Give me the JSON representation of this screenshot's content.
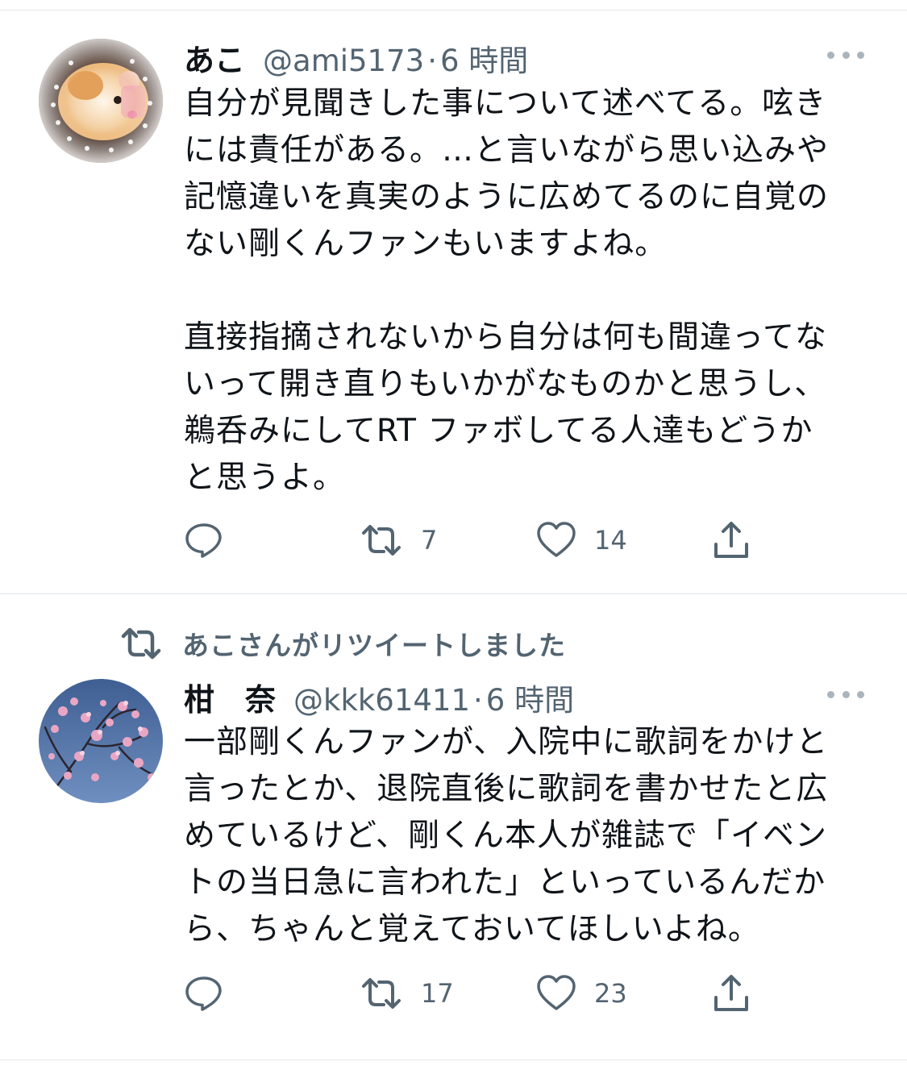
{
  "tweets": [
    {
      "name": "あこ",
      "handle": "@ami5173",
      "separator": "·",
      "time": "6 時間",
      "avatar_icon": "hamster-avatar",
      "text": "自分が見聞きした事について述べてる。呟き\nには責任がある。…と言いながら思い込みや\n記憶違いを真実のように広めてるのに自覚の\nない剛くんファンもいますよね。\n\n直接指摘されないから自分は何も間違ってな\nいって開き直りもいかがなものかと思うし、\n鵜呑みにしてRT ファボしてる人達もどうか\nと思うよ。",
      "retweets": "7",
      "likes": "14"
    },
    {
      "retweeted_by": "あこさんがリツイートしました",
      "name": "柑　奈",
      "handle": "@kkk61411",
      "separator": "·",
      "time": "6 時間",
      "avatar_icon": "blossom-avatar",
      "text": "一部剛くんファンが、入院中に歌詞をかけと\n言ったとか、退院直後に歌詞を書かせたと広\nめているけど、剛くん本人が雑誌で「イベン\nトの当日急に言われた」といっているんだか\nら、ちゃんと覚えておいてほしいよね。",
      "retweets": "17",
      "likes": "23"
    }
  ],
  "colors": {
    "text": "#0f1419",
    "secondary": "#536471",
    "divider": "#e1e5e9"
  }
}
